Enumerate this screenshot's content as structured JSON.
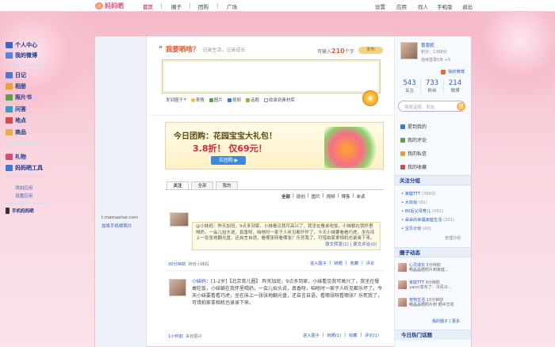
{
  "topbar": {
    "logo": "妈妈晒",
    "nav": [
      "首页",
      "圈子",
      "团购",
      "广场"
    ],
    "right": [
      "设置",
      "应用",
      "找人",
      "手机版",
      "退出"
    ]
  },
  "leftnav": {
    "primary": [
      "个人中心",
      "我的微博"
    ],
    "secondary": [
      "日记",
      "相册",
      "照片书",
      "问答",
      "地点",
      "商品"
    ],
    "tertiary": [
      "礼物",
      "妈妈晒工具"
    ],
    "links": [
      "添加应用",
      "设置应用"
    ],
    "mobile_title": "手机妈妈晒",
    "mobile_domain": "t.mamashai.com",
    "mobile_link": "加将手机晒照片"
  },
  "share": {
    "title": "我要晒啥？",
    "subtitle": "记录生活，记录成长",
    "count_prefix": "可输入",
    "count_value": "210",
    "count_suffix": "个字",
    "top_button": "发布",
    "tools": [
      "发到圈子",
      "表情",
      "图片",
      "视频",
      "话题",
      "收录到素材库"
    ],
    "sun_label": "晒"
  },
  "banner": {
    "line1": "今日团购：花园宝宝大礼包！",
    "line2": "3.8折！  仅69元！",
    "button": "去团购 ▶"
  },
  "tabs": [
    "关注",
    "全部",
    "我的"
  ],
  "filter": [
    "全部",
    "原创",
    "图片",
    "视频",
    "博客",
    "未读"
  ],
  "feed": [
    {
      "quote": "@小妹妈：昨天加班，9点多到家，小妹看见我可高兴了，我坐在餐桌吃饭，小妹躺在我怀里喝奶，一会儿抬头说，真香呀，咱啥时一家子人听见都开怀了。今天小妹要看看巧虎，坐在床上一张张地翻光盘，还自言自语，看哪张呀看哪张？乐死我了，可惜拍家拿相机也录录下来。",
      "repost": "原文转发(1) | 原文评论(0)",
      "time": "30分钟前",
      "via": "转自小妹妈",
      "actions": [
        "进入圈子",
        "转晒",
        "收藏",
        "评论"
      ]
    },
    {
      "author": "小妹妈",
      "text": "：[1-2岁]【北京育儿圈】 昨天加班，9点多到家，小妹看见我可高兴了，我坐在餐桌吃饭，小妹躺在我怀里喝奶，一会儿抬头说，真香呀，咱啥时一家子人听见都乐坏了。今天小妹要看看巧虎，坐在床上一张张地翻光盘，还自言自语，看哪张呀看哪张？乐死我了，可惜拍家拿相机也录录下来。",
      "time": "1小时前",
      "via": "来自圈子",
      "actions": [
        "进入圈子",
        "转晒(1)",
        "收藏",
        "评论(1)"
      ]
    }
  ],
  "profile": {
    "name": "蕾蕾妮",
    "points": "积分：1368分",
    "login": "连续登录5天  +5",
    "weibo_link": "我的微博",
    "stats": [
      {
        "n": "543",
        "l": "关注"
      },
      {
        "n": "733",
        "l": "粉丝"
      },
      {
        "n": "214",
        "l": "微博"
      }
    ],
    "search_placeholder": "搜索话题、朋友",
    "search_go": "搜"
  },
  "right_menu": [
    "提到我的",
    "我的评论",
    "我的私信",
    "我的收藏"
  ],
  "groups": {
    "title": "关注分组",
    "items": [
      {
        "name": "家庭TTT",
        "count": "(3663)"
      },
      {
        "name": "大杂烩",
        "count": "(81)"
      },
      {
        "name": "80后父母育儿",
        "count": "(581)"
      },
      {
        "name": "朵朵的幸福家庭生活",
        "count": "(251)"
      },
      {
        "name": "宝贝计划",
        "count": "(43)"
      }
    ],
    "footer": "管理分组"
  },
  "dynamics": {
    "title": "圈子动态",
    "items": [
      {
        "name": "心灵成长",
        "time": "5分钟前",
        "desc": "畅晶晶晒照片到家庭..."
      },
      {
        "name": "家庭TTT",
        "time": "9分钟前",
        "desc": "yanni发布了：冷风冷..."
      },
      {
        "name": "宠物生活",
        "time": "13分钟前",
        "desc": "畅晶晶晒照片到 晒中华花"
      }
    ],
    "footer": "我的圈子 | 更多"
  },
  "hot_topics": "今日热门话题"
}
